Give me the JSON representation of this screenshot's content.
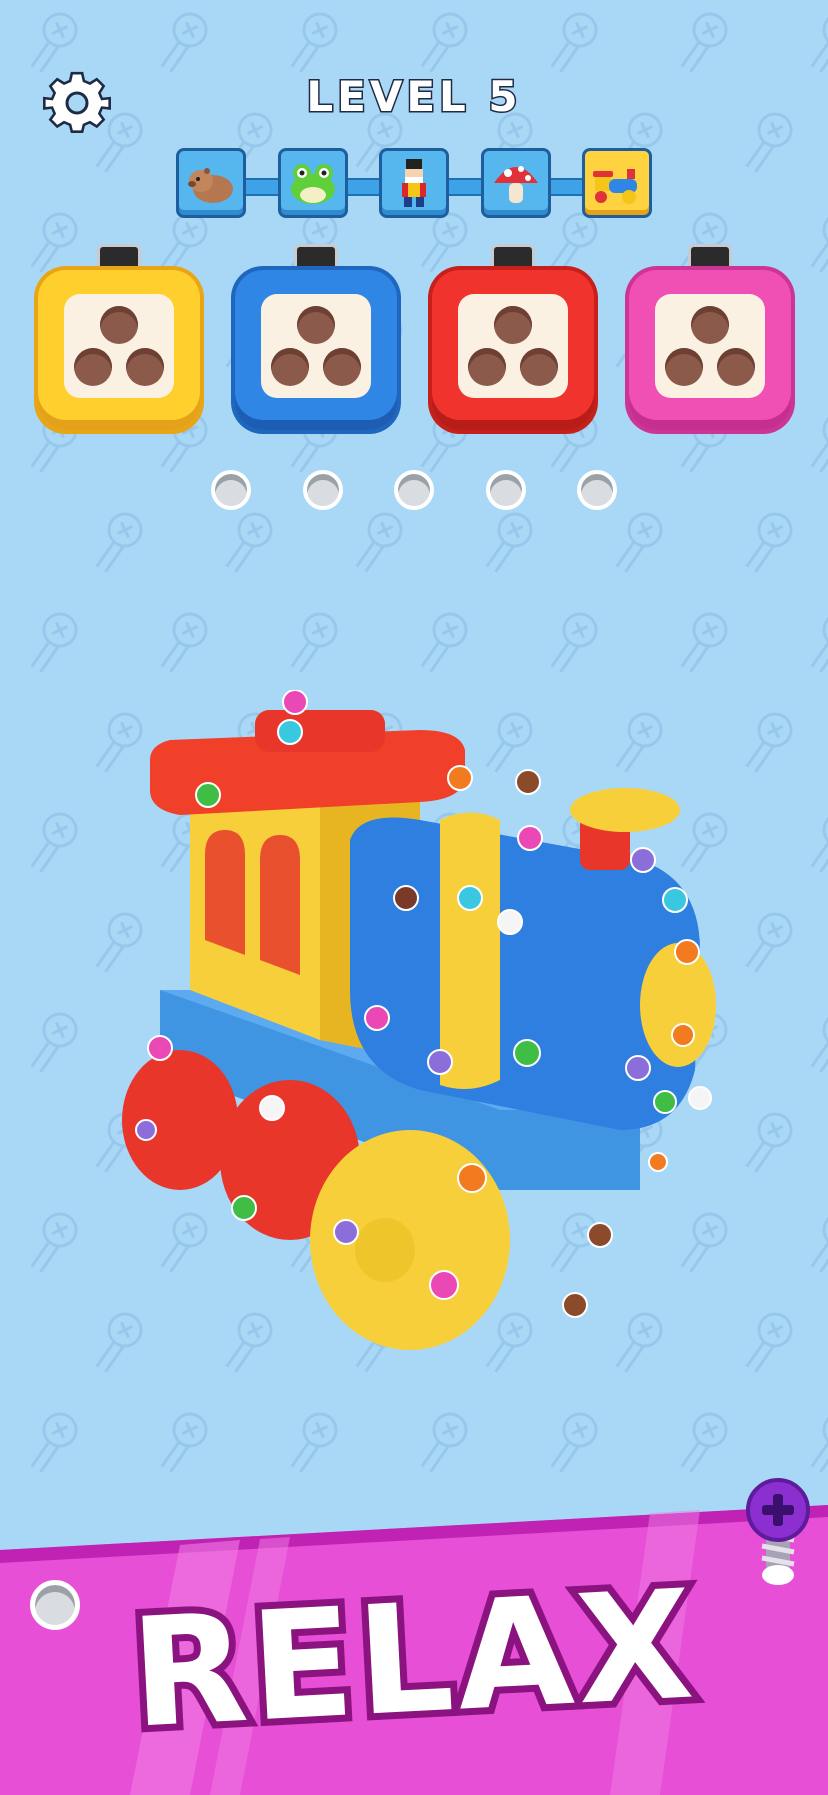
{
  "header": {
    "level_label": "LEVEL 5",
    "settings_icon": "gear-icon"
  },
  "level_progress": {
    "nodes": [
      {
        "icon": "capybara-icon",
        "state": "done"
      },
      {
        "icon": "frog-icon",
        "state": "done"
      },
      {
        "icon": "nutcracker-icon",
        "state": "done"
      },
      {
        "icon": "mushroom-icon",
        "state": "done"
      },
      {
        "icon": "train-icon",
        "state": "current"
      }
    ]
  },
  "screw_boxes": [
    {
      "color": "#ffcf2e",
      "holes": 3
    },
    {
      "color": "#2f86e5",
      "holes": 3
    },
    {
      "color": "#f0342d",
      "holes": 3
    },
    {
      "color": "#f04fb4",
      "holes": 3
    }
  ],
  "buffer_slots": {
    "count": 5
  },
  "puzzle": {
    "object": "toy-train"
  },
  "banner": {
    "text": "RELAX",
    "color": "#e64fd6"
  },
  "add_screw_button": {
    "icon": "plus-icon"
  }
}
